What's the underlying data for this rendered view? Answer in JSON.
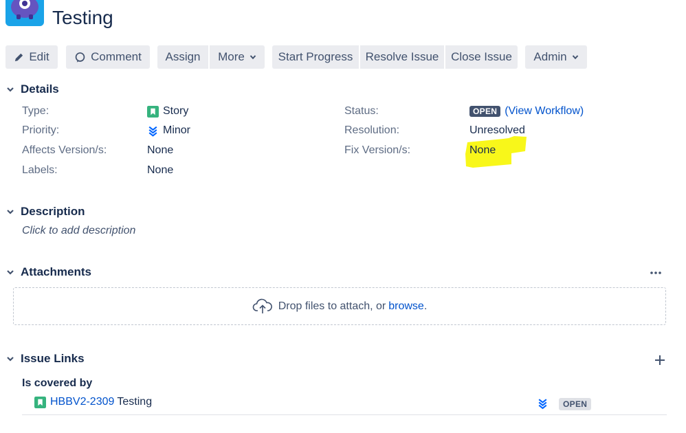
{
  "header": {
    "title": "Testing"
  },
  "toolbar": {
    "edit": "Edit",
    "comment": "Comment",
    "assign": "Assign",
    "more": "More",
    "start_progress": "Start Progress",
    "resolve_issue": "Resolve Issue",
    "close_issue": "Close Issue",
    "admin": "Admin"
  },
  "details": {
    "heading": "Details",
    "left": [
      {
        "label": "Type:",
        "value": "Story",
        "icon": "story-icon"
      },
      {
        "label": "Priority:",
        "value": "Minor",
        "icon": "priority-minor-icon"
      },
      {
        "label": "Affects Version/s:",
        "value": "None"
      },
      {
        "label": "Labels:",
        "value": "None"
      }
    ],
    "right": [
      {
        "label": "Status:",
        "badge": "OPEN",
        "link_prefix": "(",
        "link": "View Workflow",
        "link_suffix": ")"
      },
      {
        "label": "Resolution:",
        "value": "Unresolved"
      },
      {
        "label": "Fix Version/s:",
        "value": "None"
      }
    ]
  },
  "description": {
    "heading": "Description",
    "placeholder": "Click to add description"
  },
  "attachments": {
    "heading": "Attachments",
    "drop_text": "Drop files to attach, or",
    "browse": "browse",
    "drop_suffix": "."
  },
  "issue_links": {
    "heading": "Issue Links",
    "relation": "Is covered by",
    "items": [
      {
        "key": "HBBV2-2309",
        "summary": "Testing",
        "status": "OPEN"
      }
    ]
  },
  "colors": {
    "accent": "#0052cc",
    "story": "#36b37e",
    "highlight": "#f8f71a",
    "avatar": "#1aa3e8"
  }
}
